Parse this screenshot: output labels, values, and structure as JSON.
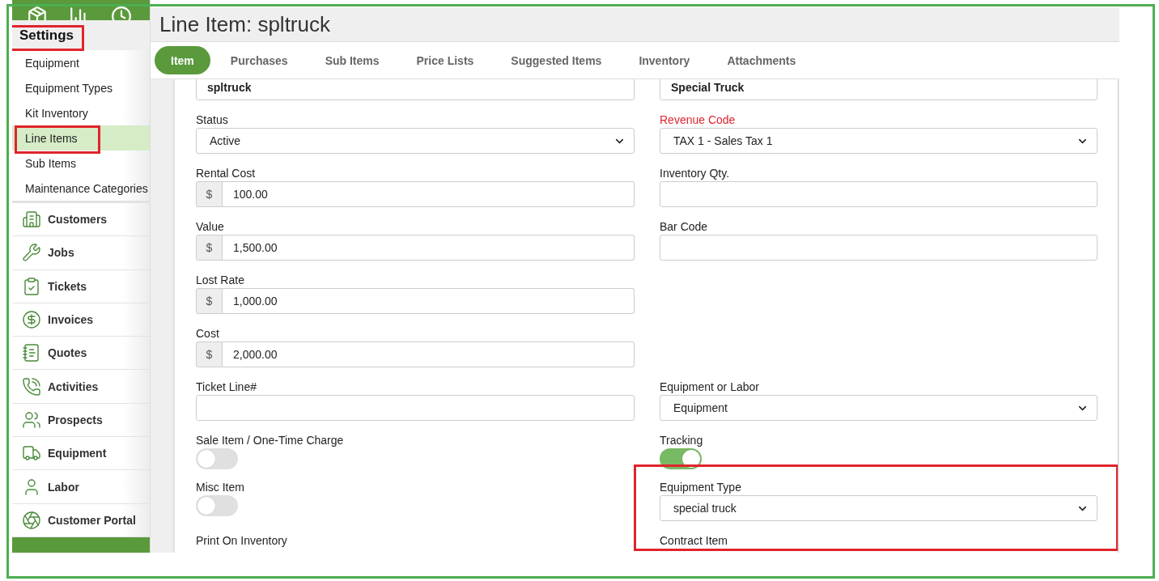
{
  "sidebar": {
    "header": {
      "title": "Settings",
      "highlighted": true
    },
    "sub_items": [
      {
        "label": "Equipment",
        "selected": false,
        "highlighted": false
      },
      {
        "label": "Equipment Types",
        "selected": false,
        "highlighted": false
      },
      {
        "label": "Kit Inventory",
        "selected": false,
        "highlighted": false
      },
      {
        "label": "Line Items",
        "selected": true,
        "highlighted": true
      },
      {
        "label": "Sub Items",
        "selected": false,
        "highlighted": false
      },
      {
        "label": "Maintenance Categories",
        "selected": false,
        "highlighted": false
      }
    ],
    "nav_items": [
      {
        "label": "Customers"
      },
      {
        "label": "Jobs"
      },
      {
        "label": "Tickets"
      },
      {
        "label": "Invoices"
      },
      {
        "label": "Quotes"
      },
      {
        "label": "Activities"
      },
      {
        "label": "Prospects"
      },
      {
        "label": "Equipment"
      },
      {
        "label": "Labor"
      },
      {
        "label": "Customer Portal"
      }
    ]
  },
  "page": {
    "title": "Line Item: spltruck"
  },
  "tabs": [
    {
      "label": "Item",
      "selected": true
    },
    {
      "label": "Purchases",
      "selected": false
    },
    {
      "label": "Sub Items",
      "selected": false
    },
    {
      "label": "Price Lists",
      "selected": false
    },
    {
      "label": "Suggested Items",
      "selected": false
    },
    {
      "label": "Inventory",
      "selected": false
    },
    {
      "label": "Attachments",
      "selected": false
    }
  ],
  "rows": [
    {
      "left": {
        "kind": "text",
        "value": "spltruck",
        "bold": true,
        "required": false
      },
      "right": {
        "kind": "text",
        "value": "Special Truck",
        "bold": true,
        "required": false
      }
    },
    {
      "left": {
        "kind": "select",
        "label": "Status",
        "value": "Active",
        "required": false
      },
      "right": {
        "kind": "select",
        "label": "Revenue Code",
        "value": "TAX 1 - Sales Tax 1",
        "required": true
      }
    },
    {
      "left": {
        "kind": "money",
        "label": "Rental Cost",
        "prefix": "$",
        "value": "100.00",
        "required": false
      },
      "right": {
        "kind": "text",
        "label": "Inventory Qty.",
        "required": false
      }
    },
    {
      "left": {
        "kind": "money",
        "label": "Value",
        "prefix": "$",
        "value": "1,500.00",
        "required": false
      },
      "right": {
        "kind": "text",
        "label": "Bar Code",
        "required": false
      }
    },
    {
      "left": {
        "kind": "money",
        "label": "Lost Rate",
        "prefix": "$",
        "value": "1,000.00",
        "required": false
      }
    },
    {
      "left": {
        "kind": "money",
        "label": "Cost",
        "prefix": "$",
        "value": "2,000.00",
        "required": false
      }
    },
    {
      "left": {
        "kind": "text",
        "label": "Ticket Line#",
        "required": false
      },
      "right": {
        "kind": "select",
        "label": "Equipment or Labor",
        "value": "Equipment",
        "required": false
      }
    },
    {
      "left": {
        "kind": "toggle",
        "label": "Sale Item / One-Time Charge",
        "on": false,
        "required": false
      },
      "right": {
        "kind": "toggle",
        "label": "Tracking",
        "on": true,
        "required": false
      }
    },
    {
      "left": {
        "kind": "toggle",
        "label": "Misc Item",
        "on": false,
        "required": false
      },
      "right": {
        "kind": "select",
        "label": "Equipment Type",
        "value": "special truck",
        "required": false,
        "highlighted": true
      }
    },
    {
      "left": {
        "kind": "label",
        "label": "Print On Inventory",
        "required": false
      },
      "right": {
        "kind": "label",
        "label": "Contract Item",
        "required": false
      }
    }
  ]
}
